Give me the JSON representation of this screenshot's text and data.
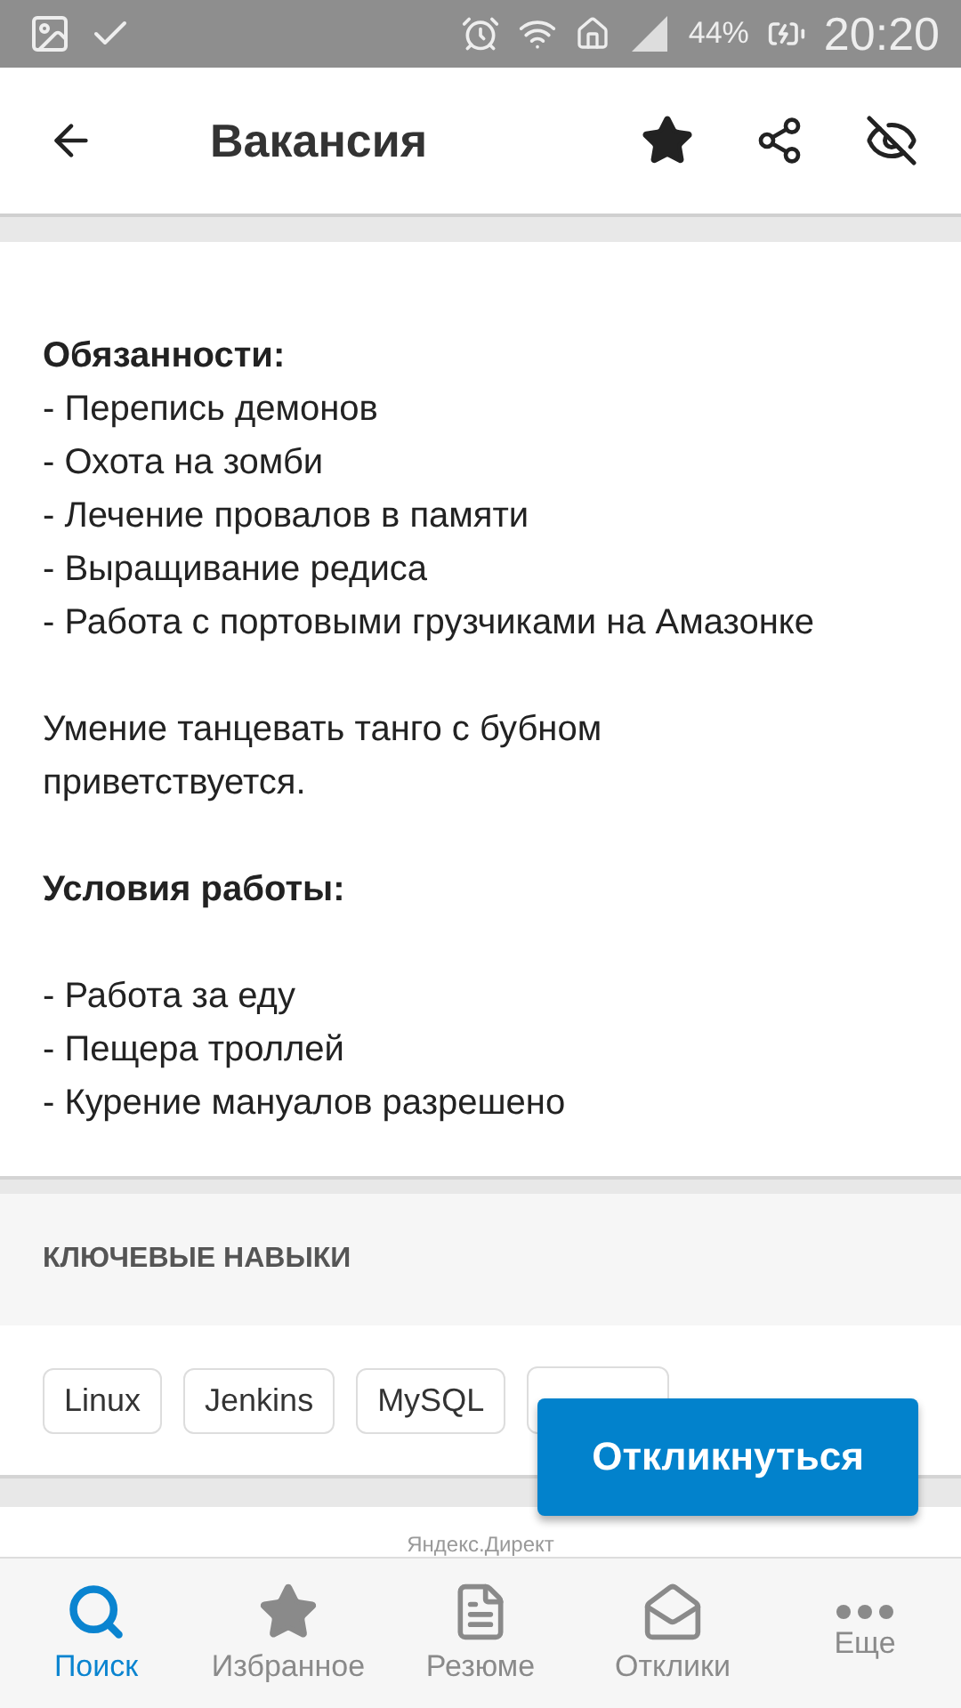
{
  "status_bar": {
    "battery": "44%",
    "time": "20:20"
  },
  "app_bar": {
    "title": "Вакансия"
  },
  "description": [
    {
      "kind": "heading",
      "text": "Обязанности:"
    },
    {
      "kind": "list",
      "items": [
        "- Перепись демонов",
        "- Охота на зомби",
        "- Лечение провалов в памяти",
        "- Выращивание редиса",
        "- Работа с портовыми грузчиками на Амазонке"
      ]
    },
    {
      "kind": "blank"
    },
    {
      "kind": "paragraph",
      "text": "Умение танцевать танго с бубном приветствуется."
    },
    {
      "kind": "blank"
    },
    {
      "kind": "heading",
      "text": "Условия работы:"
    },
    {
      "kind": "blank"
    },
    {
      "kind": "list",
      "items": [
        "- Работа за еду",
        "- Пещера троллей",
        "- Курение мануалов разрешено"
      ]
    }
  ],
  "skills": {
    "title": "КЛЮЧЕВЫЕ НАВЫКИ",
    "chips": [
      "Linux",
      "Jenkins",
      "MySQL"
    ]
  },
  "apply_button": "Откликнуться",
  "ad_label": "Яндекс.Директ",
  "bottom_nav": [
    {
      "label": "Поиск",
      "selected": true
    },
    {
      "label": "Избранное",
      "selected": false
    },
    {
      "label": "Резюме",
      "selected": false
    },
    {
      "label": "Отклики",
      "selected": false
    },
    {
      "label": "Еще",
      "selected": false
    }
  ]
}
